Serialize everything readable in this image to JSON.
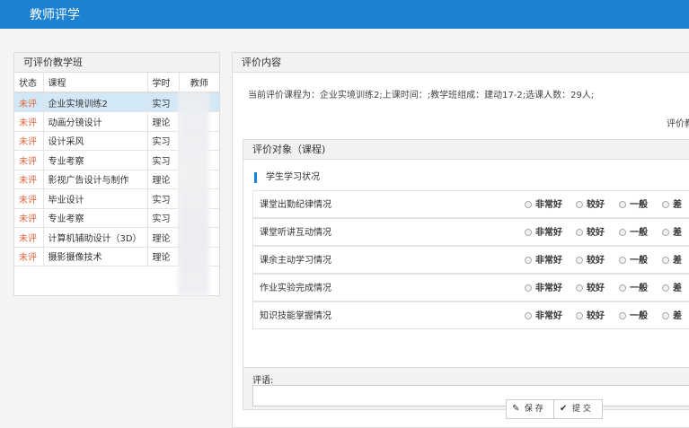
{
  "header": {
    "title": "教师评学"
  },
  "left_panel": {
    "title": "可评价教学班",
    "columns": [
      "状态",
      "课程",
      "学时",
      "教师"
    ],
    "rows": [
      {
        "status": "未评",
        "course": "企业实境训练2",
        "hours": "实习",
        "selected": true
      },
      {
        "status": "未评",
        "course": "动画分镜设计",
        "hours": "理论"
      },
      {
        "status": "未评",
        "course": "设计采风",
        "hours": "实习"
      },
      {
        "status": "未评",
        "course": "专业考察",
        "hours": "实习"
      },
      {
        "status": "未评",
        "course": "影视广告设计与制作",
        "hours": "理论"
      },
      {
        "status": "未评",
        "course": "毕业设计",
        "hours": "实习"
      },
      {
        "status": "未评",
        "course": "专业考察",
        "hours": "实习"
      },
      {
        "status": "未评",
        "course": "计算机辅助设计（3D）",
        "hours": "理论"
      },
      {
        "status": "未评",
        "course": "摄影摄像技术",
        "hours": "理论"
      }
    ]
  },
  "right_panel": {
    "title": "评价内容",
    "info": "当前评价课程为：企业实境训练2;上课时间：;教学班组成：建动17-2;选课人数：29人;",
    "info_right": "评价教",
    "object_title": "评价对象（课程)",
    "section_title": "学生学习状况",
    "criteria": [
      "课堂出勤纪律情况",
      "课堂听讲互动情况",
      "课余主动学习情况",
      "作业实验完成情况",
      "知识技能掌握情况"
    ],
    "options": [
      "非常好",
      "较好",
      "一般",
      "差"
    ],
    "remark_label": "评语:",
    "remark_value": ""
  },
  "buttons": {
    "save": "保 存",
    "submit": "提 交"
  }
}
